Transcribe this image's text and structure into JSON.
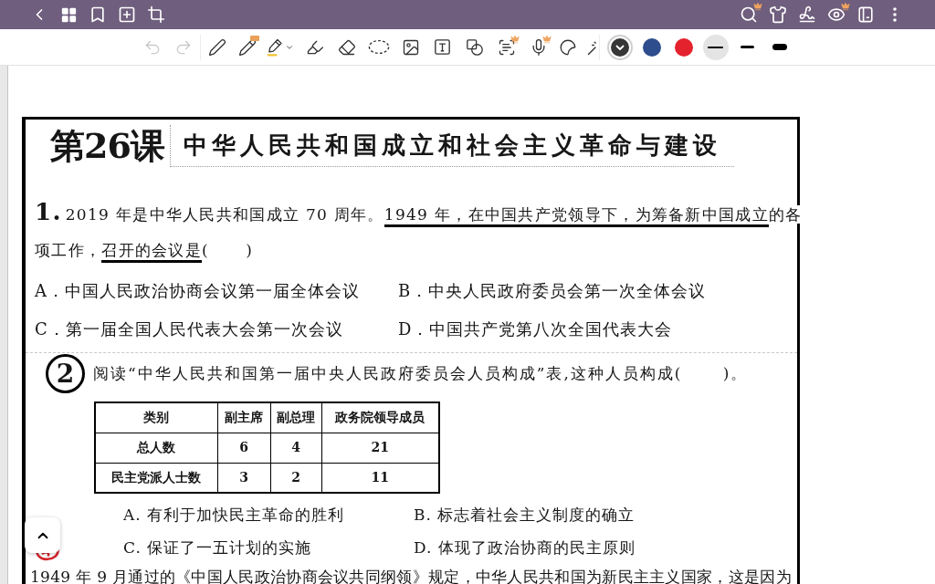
{
  "app_bar": {
    "left_buttons": [
      {
        "kind": "back"
      },
      {
        "kind": "grid"
      },
      {
        "kind": "bookmark"
      },
      {
        "kind": "add_page"
      },
      {
        "kind": "crop"
      }
    ],
    "right_buttons": [
      {
        "kind": "search",
        "premium": true
      },
      {
        "kind": "shirt"
      },
      {
        "kind": "signature"
      },
      {
        "kind": "eye",
        "premium": true
      },
      {
        "kind": "panel"
      },
      {
        "kind": "more"
      }
    ]
  },
  "toolbar": {
    "history": [
      {
        "kind": "undo",
        "disabled": true
      },
      {
        "kind": "redo",
        "disabled": true
      }
    ],
    "tools": [
      {
        "kind": "pen"
      },
      {
        "kind": "pencil",
        "new": true
      },
      {
        "kind": "brush"
      },
      {
        "kind": "highlighter"
      },
      {
        "kind": "eraser"
      },
      {
        "kind": "lasso"
      },
      {
        "kind": "image"
      },
      {
        "kind": "text"
      },
      {
        "kind": "shapes"
      },
      {
        "kind": "ocr",
        "premium": true
      },
      {
        "kind": "voice",
        "premium": true
      },
      {
        "kind": "sticker"
      },
      {
        "kind": "laser"
      }
    ],
    "colors": [
      {
        "color": "#363636",
        "selected": true
      },
      {
        "color": "#2e4d8d",
        "selected": false
      },
      {
        "color": "#e4222d",
        "selected": false
      }
    ],
    "strokes": [
      {
        "kind": "thin",
        "selected": true
      },
      {
        "kind": "medium",
        "selected": false
      },
      {
        "kind": "thick",
        "selected": false
      }
    ]
  },
  "worksheet": {
    "lesson": "第26课",
    "title": "中华人民共和国成立和社会主义革命与建设",
    "questions": [
      {
        "kind": "plain",
        "number": "1.",
        "stem_lines": [
          [
            {
              "text": "2019 年是中华人民共和国成立 70 周年。",
              "underlined": false
            },
            {
              "text": "1949 年，在中国共产党领导下，为筹备新中国成立",
              "underlined": true
            },
            {
              "text": "的各",
              "underlined": false
            }
          ],
          [
            {
              "text": "项工作，",
              "underlined": false
            },
            {
              "text": "召开的会议是",
              "underlined": true
            },
            {
              "text": "(      )",
              "underlined": false
            }
          ]
        ],
        "options": [
          "A．中国人民政治协商会议第一届全体会议",
          "B．中央人民政府委员会第一次全体会议",
          "C．第一届全国人民代表大会第一次会议",
          "D．中国共产党第八次全国代表大会"
        ]
      },
      {
        "kind": "circled",
        "number": "2",
        "stem": "阅读“中华人民共和国第一届中央人民政府委员会人员构成”表,这种人员构成(      )。",
        "table": {
          "columns": [
            "类别",
            "副主席",
            "副总理",
            "政务院领导成员"
          ],
          "rows": [
            [
              "总人数",
              "6",
              "4",
              "21"
            ],
            [
              "民主党派人士数",
              "3",
              "2",
              "11"
            ]
          ]
        },
        "options": [
          "A. 有利于加快民主革命的胜利",
          "B. 标志着社会主义制度的确立",
          "C. 保证了一五计划的实施",
          "D. 体现了政治协商的民主原则"
        ]
      },
      {
        "kind": "ink_mark",
        "stem": "1949 年 9 月通过的《中国人民政治协商会议共同纲领》规定，中华人民共和国为新民主主义国家，这是因为"
      }
    ]
  }
}
